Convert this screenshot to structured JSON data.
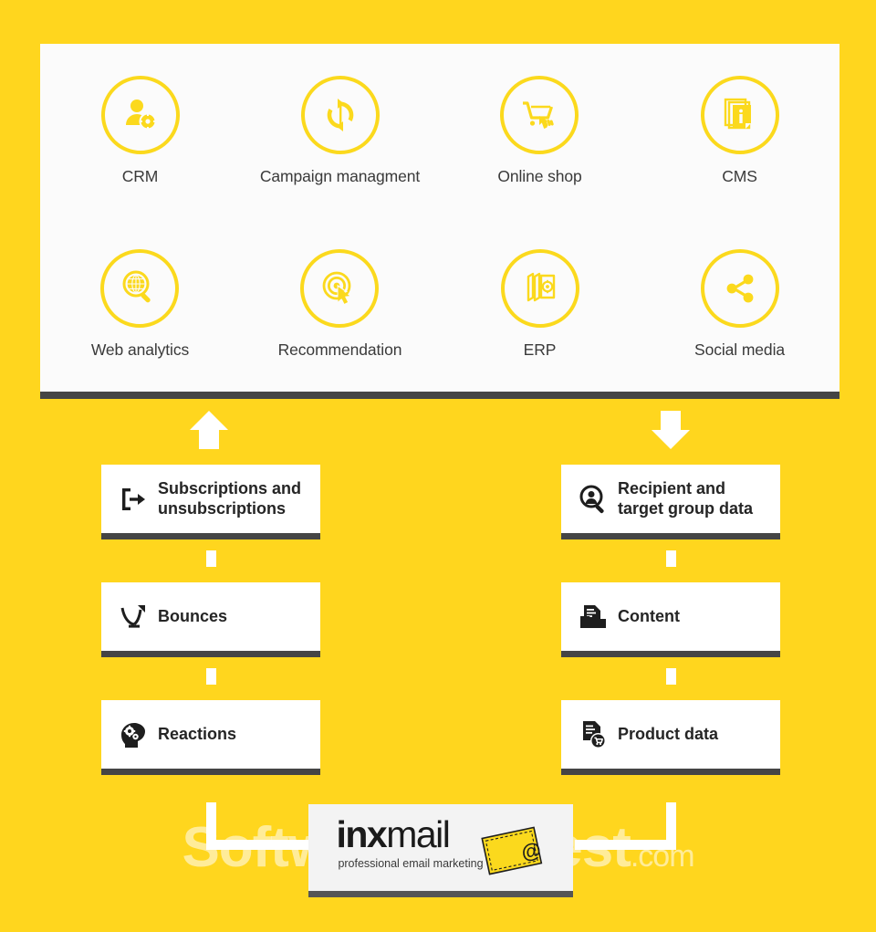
{
  "theme": {
    "background_color": "#FFD61E",
    "panel_color": "#FBFBFB",
    "accent_color": "#FBD91D",
    "dark_color": "#454545",
    "box_color": "#FFFFFF",
    "text_color": "#252525"
  },
  "integrations": {
    "items": [
      {
        "label": "CRM",
        "icon": "user-gear-icon"
      },
      {
        "label": "Campaign managment",
        "icon": "sync-arrows-icon"
      },
      {
        "label": "Online shop",
        "icon": "shopping-cart-click-icon"
      },
      {
        "label": "CMS",
        "icon": "stacked-pages-info-icon"
      },
      {
        "label": "Web analytics",
        "icon": "globe-magnifier-icon"
      },
      {
        "label": "Recommendation",
        "icon": "target-cursor-icon"
      },
      {
        "label": "ERP",
        "icon": "layered-documents-gear-icon"
      },
      {
        "label": "Social media",
        "icon": "share-nodes-icon"
      }
    ]
  },
  "flow": {
    "left_column": {
      "direction_icon": "arrow-up-icon",
      "boxes": [
        {
          "label": "Subscriptions and unsubscriptions",
          "icon": "exit-arrow-icon"
        },
        {
          "label": "Bounces",
          "icon": "bounce-arrow-icon"
        },
        {
          "label": "Reactions",
          "icon": "head-gears-icon"
        }
      ]
    },
    "right_column": {
      "direction_icon": "arrow-down-icon",
      "boxes": [
        {
          "label": "Recipient and target group data",
          "icon": "person-magnifier-icon"
        },
        {
          "label": "Content",
          "icon": "document-folder-icon"
        },
        {
          "label": "Product data",
          "icon": "document-cart-icon"
        }
      ]
    }
  },
  "logo": {
    "wordmark_bold": "inx",
    "wordmark_light": "mail",
    "tagline": "professional email marketing",
    "envelope_symbol": "@",
    "envelope_color": "#FBD91D"
  },
  "watermark": {
    "text": "SoftwareSuggest",
    "tld": ".com"
  }
}
